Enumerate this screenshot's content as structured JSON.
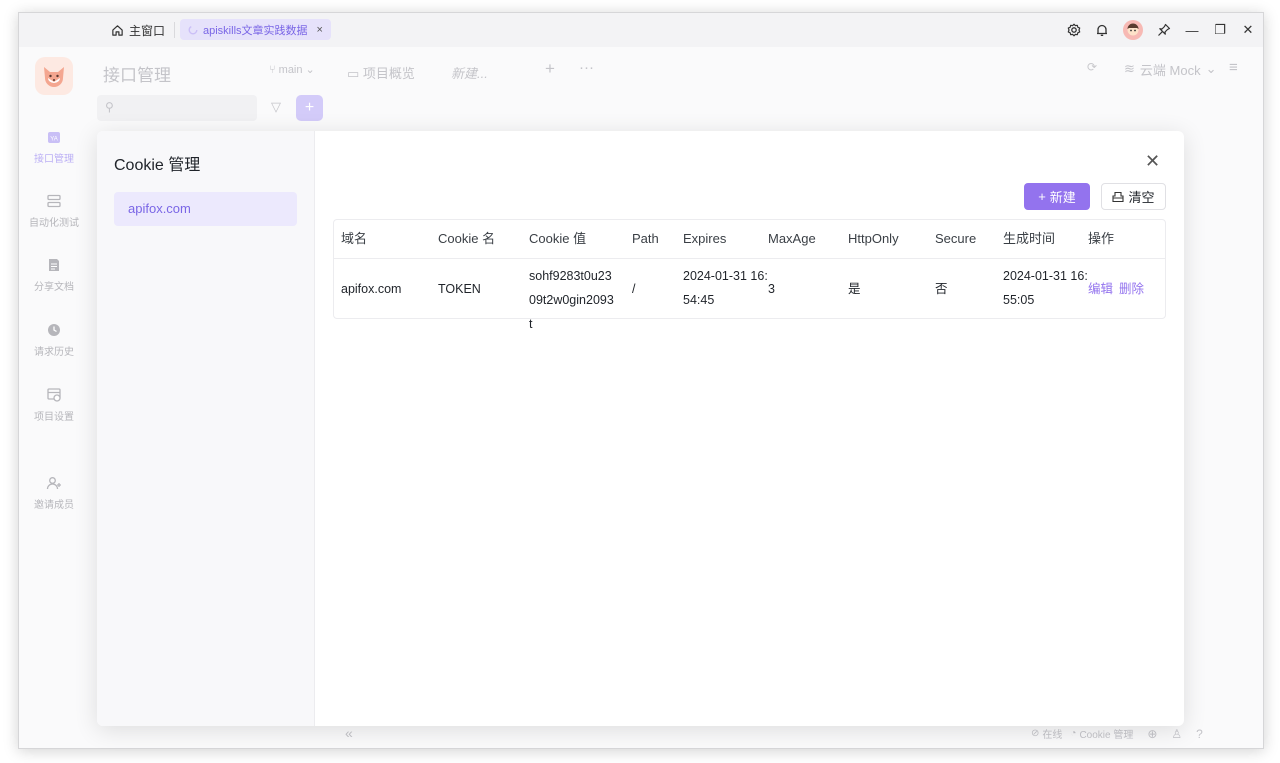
{
  "titlebar": {
    "home_label": "主窗口",
    "tab_label": "apiskills文章实践数据",
    "tab_close": "×",
    "controls": {
      "pin": "⚲",
      "minimize": "—",
      "restore": "❐",
      "close": "✕"
    }
  },
  "leftnav": {
    "items": [
      {
        "label": "接口管理",
        "icon": "api-icon"
      },
      {
        "label": "自动化测试",
        "icon": "automation-icon"
      },
      {
        "label": "分享文档",
        "icon": "share-doc-icon"
      },
      {
        "label": "请求历史",
        "icon": "history-icon"
      },
      {
        "label": "项目设置",
        "icon": "settings-icon"
      },
      {
        "label": "邀请成员",
        "icon": "invite-icon"
      }
    ]
  },
  "background": {
    "title": "接口管理",
    "branch": "main",
    "overview": "项目概览",
    "new_tab": "新建...",
    "mock": "云端 Mock",
    "status_online": "在线",
    "status_cookie": "Cookie 管理"
  },
  "modal": {
    "title": "Cookie 管理",
    "domains": [
      "apifox.com"
    ],
    "new_button": "新建",
    "clear_button": "清空",
    "columns": [
      "域名",
      "Cookie 名",
      "Cookie 值",
      "Path",
      "Expires",
      "MaxAge",
      "HttpOnly",
      "Secure",
      "生成时间",
      "操作"
    ],
    "rows": [
      {
        "domain": "apifox.com",
        "name": "TOKEN",
        "value": "sohf9283t0u2309t2w0gin2093t",
        "path": "/",
        "expires": "2024-01-31 16:54:45",
        "maxage": "3",
        "httponly": "是",
        "secure": "否",
        "created": "2024-01-31 16:55:05",
        "edit": "编辑",
        "delete": "删除"
      }
    ]
  },
  "colors": {
    "accent": "#9373ee",
    "accent_light": "#ece9fd"
  }
}
